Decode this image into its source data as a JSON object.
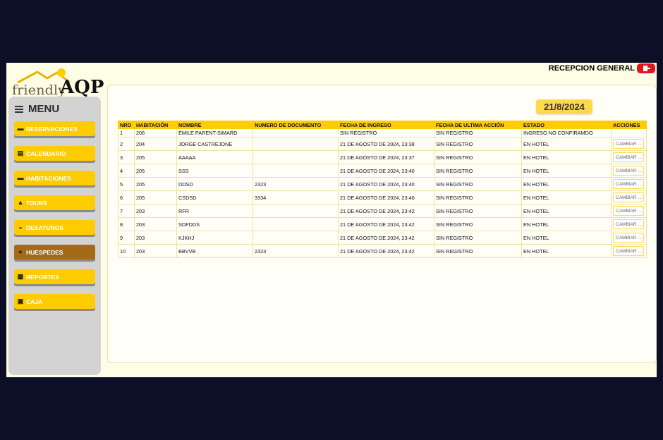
{
  "brand": {
    "friendly": "friendly",
    "aqp": "AQP"
  },
  "header": {
    "user_role": "RECEPCION GENERAL",
    "logout_icon": "logout-icon"
  },
  "sidebar": {
    "title": "MENU",
    "items": [
      {
        "label": "RESERVACIONES",
        "icon": "bed-icon",
        "active": false
      },
      {
        "label": "CALENDARIO",
        "icon": "calendar-icon",
        "active": false
      },
      {
        "label": "HABITACIONES",
        "icon": "bed-icon",
        "active": false
      },
      {
        "label": "TOURS",
        "icon": "mountain-icon",
        "active": false
      },
      {
        "label": "DESAYUNOS",
        "icon": "breakfast-icon",
        "active": false
      },
      {
        "label": "HUESPEDES",
        "icon": "guests-icon",
        "active": true
      },
      {
        "label": "REPORTES",
        "icon": "report-icon",
        "active": false
      },
      {
        "label": "CAJA",
        "icon": "cash-register-icon",
        "active": false
      }
    ]
  },
  "main": {
    "date": "21/8/2024",
    "table": {
      "headers": [
        "NRO",
        "HABITACIÓN",
        "NOMBRE",
        "NUMERO DE DOCUMENTO",
        "FECHA DE INGRESO",
        "FECHA DE ULTIMA ACCIÓN",
        "ESTADO",
        "ACCIONES"
      ],
      "action_label": "CAMBIAR ...",
      "rows": [
        {
          "nro": "1",
          "habitacion": "206",
          "nombre": "ÉMILE PARENT-SIMARD",
          "documento": "",
          "ingreso": "SIN REGISTRO",
          "ultima": "SIN REGISTRO",
          "estado": "INGRESO NO CONFIRAMDO",
          "has_action": false
        },
        {
          "nro": "2",
          "habitacion": "204",
          "nombre": "JORGE CASTREJONE",
          "documento": "",
          "ingreso": "21 DE AGOSTO DE 2024, 23:38",
          "ultima": "SIN REGISTRO",
          "estado": "EN HOTEL",
          "has_action": true
        },
        {
          "nro": "3",
          "habitacion": "205",
          "nombre": "AAAAA",
          "documento": "",
          "ingreso": "21 DE AGOSTO DE 2024, 23:37",
          "ultima": "SIN REGISTRO",
          "estado": "EN HOTEL",
          "has_action": true
        },
        {
          "nro": "4",
          "habitacion": "205",
          "nombre": "SSS",
          "documento": "",
          "ingreso": "21 DE AGOSTO DE 2024, 23:40",
          "ultima": "SIN REGISTRO",
          "estado": "EN HOTEL",
          "has_action": true
        },
        {
          "nro": "5",
          "habitacion": "205",
          "nombre": "DDSD",
          "documento": "2323",
          "ingreso": "21 DE AGOSTO DE 2024, 23:40",
          "ultima": "SIN REGISTRO",
          "estado": "EN HOTEL",
          "has_action": true
        },
        {
          "nro": "6",
          "habitacion": "205",
          "nombre": "CSDSD",
          "documento": "3334",
          "ingreso": "21 DE AGOSTO DE 2024, 23:40",
          "ultima": "SIN REGISTRO",
          "estado": "EN HOTEL",
          "has_action": true
        },
        {
          "nro": "7",
          "habitacion": "203",
          "nombre": "RFR",
          "documento": "",
          "ingreso": "21 DE AGOSTO DE 2024, 23:42",
          "ultima": "SIN REGISTRO",
          "estado": "EN HOTEL",
          "has_action": true
        },
        {
          "nro": "8",
          "habitacion": "203",
          "nombre": "SDFDDS",
          "documento": "",
          "ingreso": "21 DE AGOSTO DE 2024, 23:42",
          "ultima": "SIN REGISTRO",
          "estado": "EN HOTEL",
          "has_action": true
        },
        {
          "nro": "9",
          "habitacion": "203",
          "nombre": "KJKHJ",
          "documento": "",
          "ingreso": "21 DE AGOSTO DE 2024, 23:42",
          "ultima": "SIN REGISTRO",
          "estado": "EN HOTEL",
          "has_action": true
        },
        {
          "nro": "10",
          "habitacion": "203",
          "nombre": "BBVVB",
          "documento": "2323",
          "ingreso": "21 DE AGOSTO DE 2024, 23:42",
          "ultima": "SIN REGISTRO",
          "estado": "EN HOTEL",
          "has_action": true
        }
      ]
    }
  },
  "colors": {
    "accent": "#ffcc00",
    "active_nav": "#a36b16",
    "danger": "#e3141d",
    "page_bg": "#fefde6"
  }
}
